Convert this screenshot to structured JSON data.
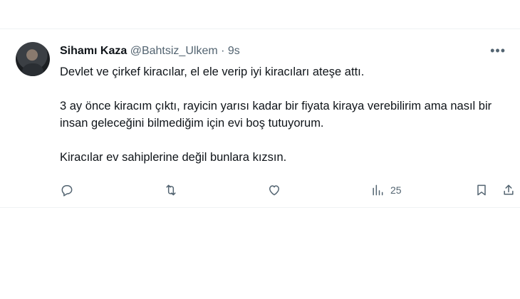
{
  "tweet": {
    "author_name": "Sihamı Kaza",
    "handle": "@Bahtsiz_Ulkem",
    "separator": "·",
    "time": "9s",
    "more_label": "•••",
    "paragraphs": [
      "Devlet ve çirkef kiracılar, el ele verip iyi kiracıları ateşe attı.",
      "3 ay önce kiracım çıktı, rayicin yarısı kadar bir fiyata kiraya verebilirim ama nasıl bir insan geleceğini bilmediğim için evi boş tutuyorum.",
      "Kiracılar ev sahiplerine değil bunlara kızsın."
    ]
  },
  "actions": {
    "reply_icon": "reply-icon",
    "retweet_icon": "retweet-icon",
    "like_icon": "heart-icon",
    "views_icon": "bar-chart-icon",
    "views_count": "25",
    "bookmark_icon": "bookmark-icon",
    "share_icon": "share-icon"
  },
  "colors": {
    "text_primary": "#0f1419",
    "text_secondary": "#536471",
    "border": "#eff3f4"
  }
}
